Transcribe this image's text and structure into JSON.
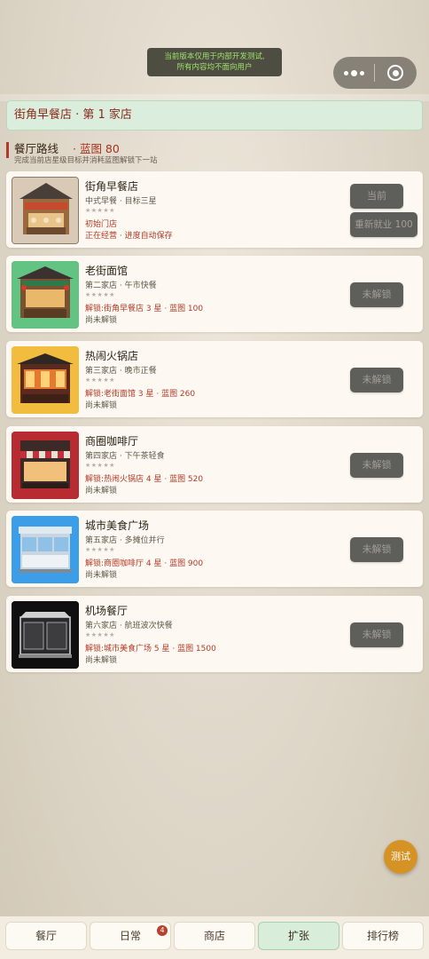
{
  "dev_notice": {
    "line1": "当前版本仅用于内部开发测试,",
    "line2": "所有内容均不面向用户"
  },
  "store_banner": "街角早餐店 · 第 1 家店",
  "route": {
    "title": "餐厅路线",
    "blueprint": "· 蓝图 80",
    "subtitle": "完成当前店星级目标并消耗蓝图解锁下一站"
  },
  "stars_text": "★★★★★",
  "restaurants": [
    {
      "name": "街角早餐店",
      "desc": "中式早餐 · 目标三星",
      "line1": "初始门店",
      "line2": "正在经营 · 进度自动保存",
      "button": "当前",
      "button2": "重新就业 100"
    },
    {
      "name": "老街面馆",
      "desc": "第二家店 · 午市快餐",
      "line1": "解锁:街角早餐店 3 星 · 蓝图 100",
      "line2": "尚未解锁",
      "button": "未解锁"
    },
    {
      "name": "热闹火锅店",
      "desc": "第三家店 · 晚市正餐",
      "line1": "解锁:老街面馆 3 星 · 蓝图 260",
      "line2": "尚未解锁",
      "button": "未解锁"
    },
    {
      "name": "商圈咖啡厅",
      "desc": "第四家店 · 下午茶轻食",
      "line1": "解锁:热闹火锅店 4 星 · 蓝图 520",
      "line2": "尚未解锁",
      "button": "未解锁"
    },
    {
      "name": "城市美食广场",
      "desc": "第五家店 · 多摊位并行",
      "line1": "解锁:商圈咖啡厅 4 星 · 蓝图 900",
      "line2": "尚未解锁",
      "button": "未解锁"
    },
    {
      "name": "机场餐厅",
      "desc": "第六家店 · 航班波次快餐",
      "line1": "解锁:城市美食广场 5 星 · 蓝图 1500",
      "line2": "尚未解锁",
      "button": "未解锁"
    }
  ],
  "fab_label": "测试",
  "tabs": [
    {
      "label": "餐厅"
    },
    {
      "label": "日常",
      "badge": "4"
    },
    {
      "label": "商店"
    },
    {
      "label": "扩张",
      "active": true
    },
    {
      "label": "排行榜"
    }
  ],
  "colors": {
    "accent_red": "#b33a28",
    "active_tab": "#d8eedb",
    "fab": "#d59326",
    "locked_button": "#5e5e5a"
  }
}
